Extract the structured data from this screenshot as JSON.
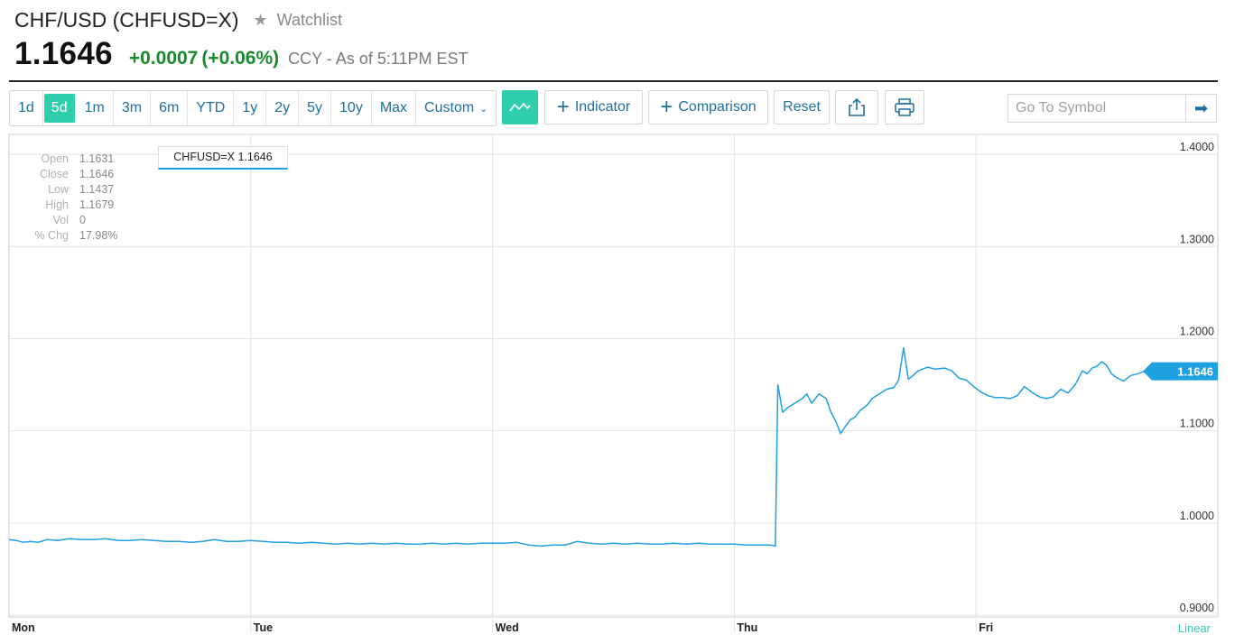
{
  "header": {
    "symbol_title": "CHF/USD (CHFUSD=X)",
    "watchlist_label": "Watchlist",
    "price": "1.1646",
    "change": "+0.0007",
    "change_pct": "(+0.06%)",
    "as_of": "CCY - As of 5:11PM EST"
  },
  "toolbar": {
    "ranges": [
      "1d",
      "5d",
      "1m",
      "3m",
      "6m",
      "YTD",
      "1y",
      "2y",
      "5y",
      "10y",
      "Max"
    ],
    "active_range": "5d",
    "custom_label": "Custom",
    "indicator_label": "Indicator",
    "comparison_label": "Comparison",
    "reset_label": "Reset",
    "goto_placeholder": "Go To Symbol"
  },
  "ohlc": {
    "rows": [
      {
        "label": "Open",
        "value": "1.1631"
      },
      {
        "label": "Close",
        "value": "1.1646"
      },
      {
        "label": "Low",
        "value": "1.1437"
      },
      {
        "label": "High",
        "value": "1.1679"
      },
      {
        "label": "Vol",
        "value": "0"
      },
      {
        "label": "% Chg",
        "value": "17.98%"
      }
    ]
  },
  "series_tag": "CHFUSD=X 1.1646",
  "chart_data": {
    "type": "line",
    "series": [
      {
        "name": "CHFUSD=X",
        "color": "#1fa0e0",
        "points": [
          [
            0.0,
            0.982
          ],
          [
            0.03,
            0.981
          ],
          [
            0.06,
            0.979
          ],
          [
            0.09,
            0.98
          ],
          [
            0.12,
            0.979
          ],
          [
            0.16,
            0.982
          ],
          [
            0.2,
            0.981
          ],
          [
            0.25,
            0.983
          ],
          [
            0.3,
            0.982
          ],
          [
            0.35,
            0.982
          ],
          [
            0.4,
            0.983
          ],
          [
            0.45,
            0.981
          ],
          [
            0.5,
            0.981
          ],
          [
            0.55,
            0.982
          ],
          [
            0.6,
            0.981
          ],
          [
            0.65,
            0.98
          ],
          [
            0.7,
            0.98
          ],
          [
            0.75,
            0.979
          ],
          [
            0.8,
            0.98
          ],
          [
            0.85,
            0.982
          ],
          [
            0.9,
            0.98
          ],
          [
            0.95,
            0.98
          ],
          [
            1.0,
            0.981
          ],
          [
            1.05,
            0.98
          ],
          [
            1.1,
            0.979
          ],
          [
            1.15,
            0.979
          ],
          [
            1.2,
            0.978
          ],
          [
            1.25,
            0.979
          ],
          [
            1.3,
            0.978
          ],
          [
            1.35,
            0.977
          ],
          [
            1.4,
            0.978
          ],
          [
            1.45,
            0.977
          ],
          [
            1.5,
            0.978
          ],
          [
            1.55,
            0.977
          ],
          [
            1.6,
            0.978
          ],
          [
            1.65,
            0.977
          ],
          [
            1.7,
            0.977
          ],
          [
            1.75,
            0.978
          ],
          [
            1.8,
            0.977
          ],
          [
            1.85,
            0.978
          ],
          [
            1.9,
            0.977
          ],
          [
            1.95,
            0.978
          ],
          [
            2.0,
            0.978
          ],
          [
            2.05,
            0.978
          ],
          [
            2.1,
            0.979
          ],
          [
            2.15,
            0.976
          ],
          [
            2.2,
            0.975
          ],
          [
            2.25,
            0.976
          ],
          [
            2.3,
            0.976
          ],
          [
            2.35,
            0.98
          ],
          [
            2.4,
            0.978
          ],
          [
            2.45,
            0.977
          ],
          [
            2.5,
            0.978
          ],
          [
            2.55,
            0.977
          ],
          [
            2.6,
            0.978
          ],
          [
            2.65,
            0.977
          ],
          [
            2.7,
            0.977
          ],
          [
            2.75,
            0.978
          ],
          [
            2.8,
            0.977
          ],
          [
            2.85,
            0.978
          ],
          [
            2.9,
            0.977
          ],
          [
            2.95,
            0.977
          ],
          [
            3.0,
            0.977
          ],
          [
            3.05,
            0.976
          ],
          [
            3.1,
            0.976
          ],
          [
            3.15,
            0.976
          ],
          [
            3.17,
            0.975
          ],
          [
            3.18,
            1.15
          ],
          [
            3.2,
            1.12
          ],
          [
            3.22,
            1.125
          ],
          [
            3.25,
            1.13
          ],
          [
            3.28,
            1.135
          ],
          [
            3.3,
            1.14
          ],
          [
            3.32,
            1.13
          ],
          [
            3.35,
            1.14
          ],
          [
            3.38,
            1.135
          ],
          [
            3.4,
            1.12
          ],
          [
            3.42,
            1.11
          ],
          [
            3.44,
            1.097
          ],
          [
            3.46,
            1.105
          ],
          [
            3.48,
            1.112
          ],
          [
            3.5,
            1.115
          ],
          [
            3.52,
            1.122
          ],
          [
            3.55,
            1.128
          ],
          [
            3.57,
            1.135
          ],
          [
            3.6,
            1.14
          ],
          [
            3.63,
            1.145
          ],
          [
            3.66,
            1.147
          ],
          [
            3.68,
            1.155
          ],
          [
            3.7,
            1.19
          ],
          [
            3.72,
            1.156
          ],
          [
            3.74,
            1.16
          ],
          [
            3.76,
            1.165
          ],
          [
            3.8,
            1.169
          ],
          [
            3.83,
            1.167
          ],
          [
            3.87,
            1.168
          ],
          [
            3.9,
            1.165
          ],
          [
            3.93,
            1.157
          ],
          [
            3.96,
            1.155
          ],
          [
            3.99,
            1.148
          ],
          [
            4.02,
            1.142
          ],
          [
            4.05,
            1.138
          ],
          [
            4.08,
            1.136
          ],
          [
            4.11,
            1.136
          ],
          [
            4.14,
            1.135
          ],
          [
            4.17,
            1.138
          ],
          [
            4.2,
            1.148
          ],
          [
            4.23,
            1.142
          ],
          [
            4.26,
            1.137
          ],
          [
            4.29,
            1.135
          ],
          [
            4.32,
            1.137
          ],
          [
            4.35,
            1.145
          ],
          [
            4.38,
            1.141
          ],
          [
            4.41,
            1.15
          ],
          [
            4.44,
            1.165
          ],
          [
            4.46,
            1.162
          ],
          [
            4.48,
            1.168
          ],
          [
            4.5,
            1.17
          ],
          [
            4.52,
            1.175
          ],
          [
            4.54,
            1.171
          ],
          [
            4.56,
            1.162
          ],
          [
            4.58,
            1.158
          ],
          [
            4.61,
            1.154
          ],
          [
            4.64,
            1.16
          ],
          [
            4.67,
            1.162
          ],
          [
            4.7,
            1.165
          ],
          [
            4.73,
            1.16
          ],
          [
            4.76,
            1.163
          ],
          [
            4.78,
            1.1646
          ]
        ]
      }
    ],
    "x_labels": [
      "Mon",
      "Tue",
      "Wed",
      "Thu",
      "Fri"
    ],
    "ylim": [
      0.9,
      1.4
    ],
    "y_ticks": [
      "0.9000",
      "1.0000",
      "1.1000",
      "1.2000",
      "1.3000",
      "1.4000"
    ],
    "last_value_label": "1.1646",
    "scale_label": "Linear",
    "grid": true
  }
}
